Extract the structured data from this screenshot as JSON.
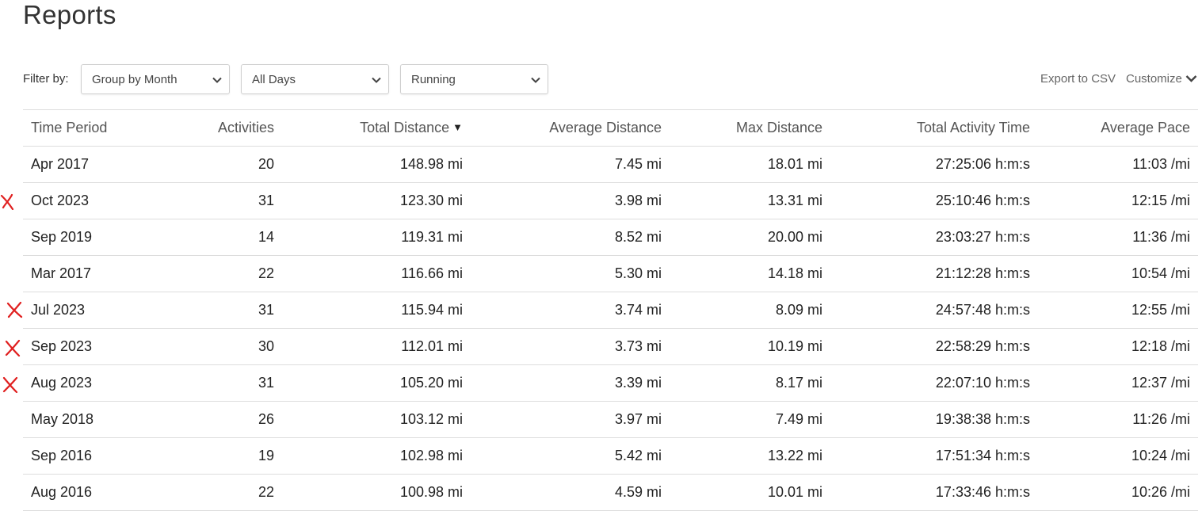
{
  "page": {
    "title": "Reports"
  },
  "filters": {
    "label": "Filter by:",
    "group": "Group by Month",
    "days": "All Days",
    "activity": "Running"
  },
  "actions": {
    "export": "Export to CSV",
    "customize": "Customize"
  },
  "table": {
    "headers": [
      "Time Period",
      "Activities",
      "Total Distance",
      "Average Distance",
      "Max Distance",
      "Total Activity Time",
      "Average Pace"
    ],
    "sorted_column": "Total Distance",
    "sort_direction": "descending",
    "rows": [
      [
        "Apr 2017",
        "20",
        "148.98 mi",
        "7.45 mi",
        "18.01 mi",
        "27:25:06 h:m:s",
        "11:03 /mi"
      ],
      [
        "Oct 2023",
        "31",
        "123.30 mi",
        "3.98 mi",
        "13.31 mi",
        "25:10:46 h:m:s",
        "12:15 /mi"
      ],
      [
        "Sep 2019",
        "14",
        "119.31 mi",
        "8.52 mi",
        "20.00 mi",
        "23:03:27 h:m:s",
        "11:36 /mi"
      ],
      [
        "Mar 2017",
        "22",
        "116.66 mi",
        "5.30 mi",
        "14.18 mi",
        "21:12:28 h:m:s",
        "10:54 /mi"
      ],
      [
        "Jul 2023",
        "31",
        "115.94 mi",
        "3.74 mi",
        "8.09 mi",
        "24:57:48 h:m:s",
        "12:55 /mi"
      ],
      [
        "Sep 2023",
        "30",
        "112.01 mi",
        "3.73 mi",
        "10.19 mi",
        "22:58:29 h:m:s",
        "12:18 /mi"
      ],
      [
        "Aug 2023",
        "31",
        "105.20 mi",
        "3.39 mi",
        "8.17 mi",
        "22:07:10 h:m:s",
        "12:37 /mi"
      ],
      [
        "May 2018",
        "26",
        "103.12 mi",
        "3.97 mi",
        "7.49 mi",
        "19:38:38 h:m:s",
        "11:26 /mi"
      ],
      [
        "Sep 2016",
        "19",
        "102.98 mi",
        "5.42 mi",
        "13.22 mi",
        "17:51:34 h:m:s",
        "10:24 /mi"
      ],
      [
        "Aug 2016",
        "22",
        "100.98 mi",
        "4.59 mi",
        "10.01 mi",
        "17:33:46 h:m:s",
        "10:26 /mi"
      ]
    ],
    "marked_rows": [
      "Oct 2023",
      "Jul 2023",
      "Sep 2023",
      "Aug 2023"
    ]
  },
  "colors": {
    "mark": "#e02020",
    "border": "#dddddd",
    "text": "#222222"
  },
  "icons": {
    "select_chevron": "chevron-down-icon",
    "mark": "red-x-mark-icon"
  }
}
